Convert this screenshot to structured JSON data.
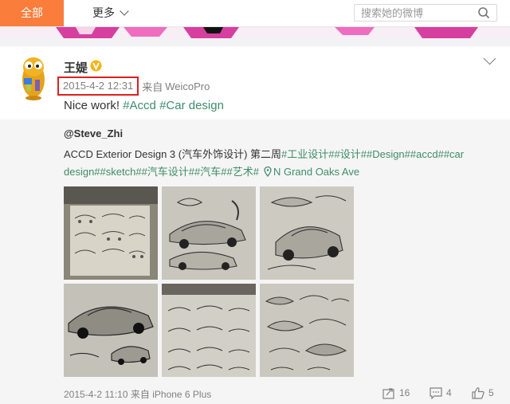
{
  "topbar": {
    "tab_all": "全部",
    "tab_more": "更多",
    "search_placeholder": "搜索她的微博"
  },
  "post": {
    "author": "王媞",
    "time": "2015-4-2 12:31",
    "source_prefix": "来自",
    "source_app": "WeicoPro",
    "text_plain": "Nice work! ",
    "tags": [
      "#Accd",
      "#Car design"
    ],
    "accent_color": "#3f8c6e",
    "highlight_color": "#e02020",
    "brand_color": "#fa7d3c"
  },
  "repost": {
    "user": "@Steve_Zhi",
    "text_plain": "ACCD Exterior Design 3 (汽车外饰设计) 第二周",
    "tags_line1": "#工业设计##设计##Design##accd##car",
    "tags_line2": "design##sketch##汽车设计##汽车##艺术#",
    "location": "N Grand Oaks Ave",
    "footer_time": "2015-4-2 11:10",
    "footer_source_prefix": "来自",
    "footer_source_app": "iPhone 6 Plus",
    "repost_count": "16",
    "comment_count": "4",
    "like_count": "5"
  }
}
